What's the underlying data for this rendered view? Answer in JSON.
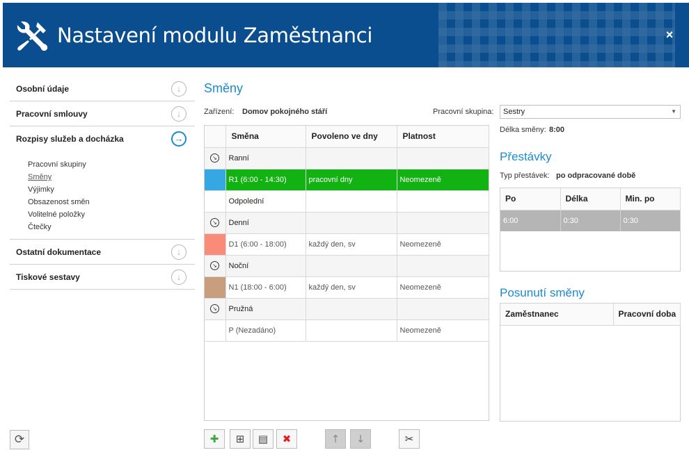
{
  "header": {
    "title": "Nastavení modulu Zaměstnanci",
    "close_label": "×",
    "bg_color": "#0b4e8f"
  },
  "sidebar": {
    "sections": [
      {
        "label": "Osobní údaje",
        "icon": "arrow-down-circle-icon"
      },
      {
        "label": "Pracovní smlouvy",
        "icon": "arrow-down-circle-icon"
      },
      {
        "label": "Rozpisy služeb a docházka",
        "icon": "arrow-right-circle-icon",
        "active": true
      },
      {
        "label": "Ostatní dokumentace",
        "icon": "arrow-down-circle-icon"
      },
      {
        "label": "Tiskové sestavy",
        "icon": "arrow-down-circle-icon"
      }
    ],
    "subitems": [
      "Pracovní skupiny",
      "Směny",
      "Výjimky",
      "Obsazenost směn",
      "Volitelné položky",
      "Čtečky"
    ],
    "current_subitem": "Směny"
  },
  "main": {
    "title": "Směny",
    "facility_label": "Zařízení:",
    "facility_value": "Domov pokojného stáří",
    "workgroup_label": "Pracovní skupina:",
    "workgroup_value": "Sestry",
    "shift_length_label": "Délka směny:",
    "shift_length_value": "8:00",
    "table": {
      "headers": [
        "Směna",
        "Povoleno ve dny",
        "Platnost"
      ],
      "rows": [
        {
          "type": "group",
          "name": "Ranní",
          "days": "",
          "validity": "",
          "color": ""
        },
        {
          "type": "shift",
          "name": "R1 (6:00 - 14:30)",
          "days": "pracovní dny",
          "validity": "Neomezeně",
          "color": "#35a8e3",
          "selected": true
        },
        {
          "type": "plain",
          "name": "Odpolední",
          "days": "",
          "validity": "",
          "color": ""
        },
        {
          "type": "group",
          "name": "Denní",
          "days": "",
          "validity": "",
          "color": ""
        },
        {
          "type": "shift",
          "name": "D1 (6:00 - 18:00)",
          "days": "každý den, sv",
          "validity": "Neomezeně",
          "color": "#f88c78"
        },
        {
          "type": "group",
          "name": "Noční",
          "days": "",
          "validity": "",
          "color": ""
        },
        {
          "type": "shift",
          "name": "N1 (18:00 - 6:00)",
          "days": "každý den, sv",
          "validity": "Neomezeně",
          "color": "#c99e7e"
        },
        {
          "type": "group",
          "name": "Pružná",
          "days": "",
          "validity": "",
          "color": ""
        },
        {
          "type": "shift",
          "name": "P (Nezadáno)",
          "days": "",
          "validity": "Neomezeně",
          "color": ""
        }
      ]
    },
    "toolbar": {
      "add": "✚",
      "add_group": "⊞",
      "edit": "▤",
      "delete": "✖",
      "up": "↑",
      "down": "↓",
      "settings": "✂"
    }
  },
  "breaks": {
    "title": "Přestávky",
    "type_label": "Typ přestávek:",
    "type_value": "po odpracované době",
    "headers": [
      "Po",
      "Délka",
      "Min. po"
    ],
    "rows": [
      [
        "6:00",
        "0:30",
        "0:30"
      ]
    ]
  },
  "shift_move": {
    "title": "Posunutí směny",
    "headers": [
      "Zaměstnanec",
      "Pracovní doba"
    ]
  },
  "refresh_label": "⟳"
}
